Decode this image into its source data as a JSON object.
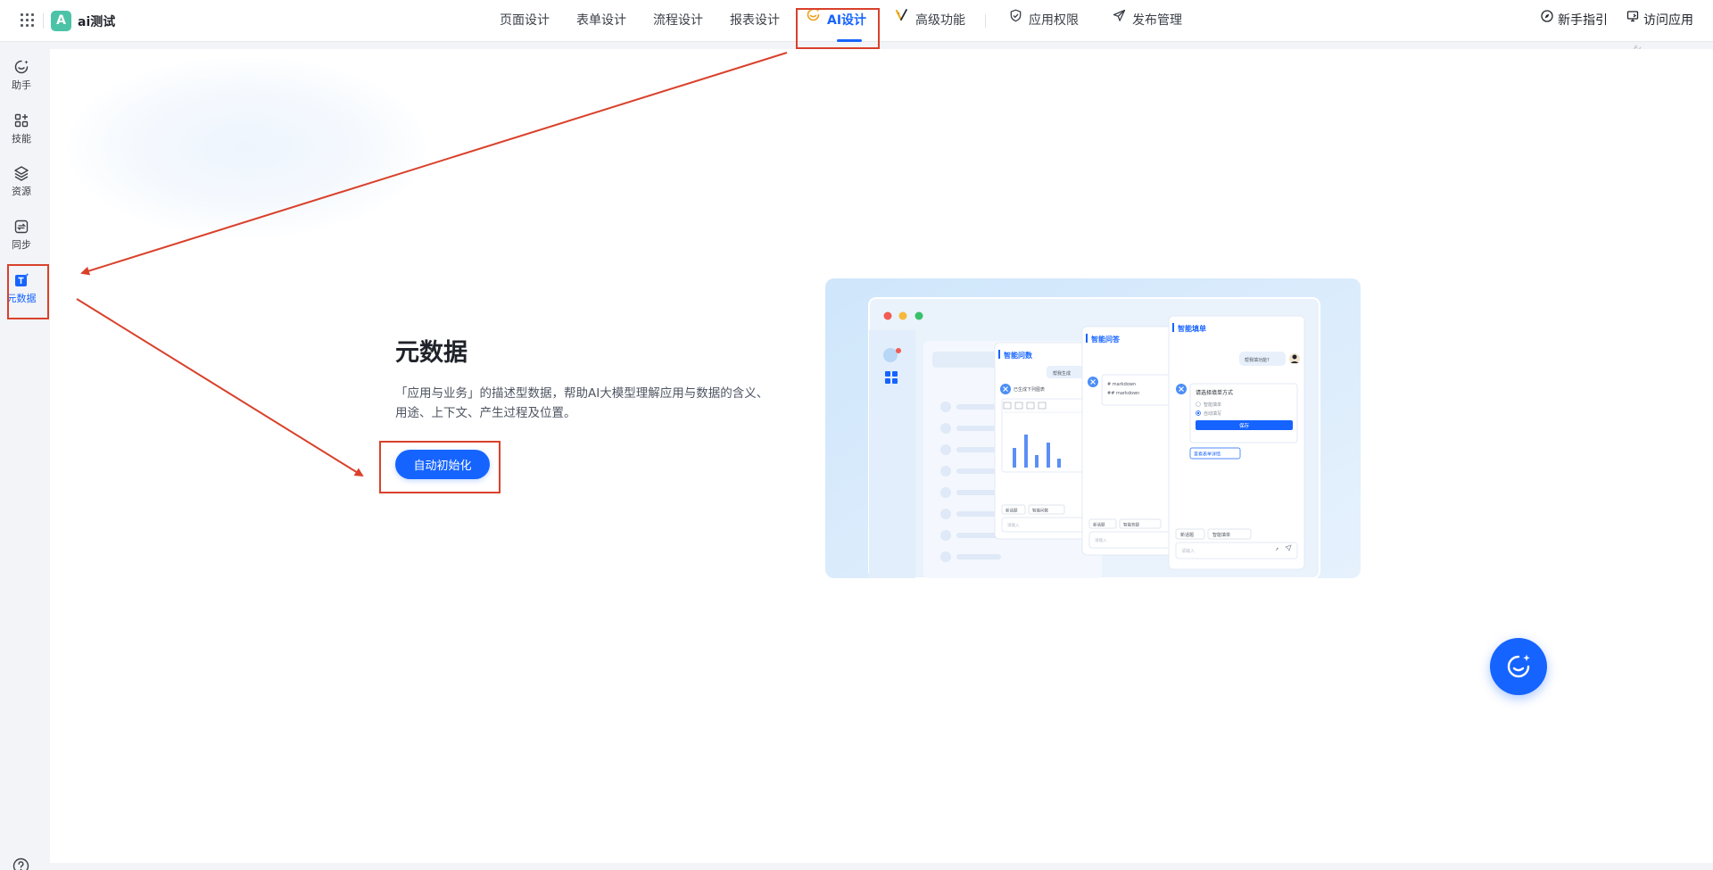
{
  "app": {
    "logo_letter": "A",
    "name": "ai测试"
  },
  "nav": {
    "items": [
      {
        "label": "页面设计"
      },
      {
        "label": "表单设计"
      },
      {
        "label": "流程设计"
      },
      {
        "label": "报表设计"
      },
      {
        "label": "AI设计",
        "active": true
      },
      {
        "label": "高级功能"
      },
      {
        "label": "应用权限"
      },
      {
        "label": "发布管理"
      }
    ]
  },
  "top_right": {
    "guide": "新手指引",
    "visit": "访问应用"
  },
  "watermark": "tke-saas-uat",
  "sidebar": {
    "items": [
      {
        "label": "助手"
      },
      {
        "label": "技能"
      },
      {
        "label": "资源"
      },
      {
        "label": "同步"
      },
      {
        "label": "元数据",
        "active": true
      }
    ]
  },
  "main": {
    "title": "元数据",
    "description": "「应用与业务」的描述型数据，帮助AI大模型理解应用与数据的含义、用途、上下文、产生过程及位置。",
    "button_label": "自动初始化"
  },
  "illustration": {
    "card1_title": "智能问数",
    "card2_title": "智能问答",
    "card3_title": "智能填单",
    "card1_bubble": "帮我生成",
    "card1_reply": "已生成下列图表",
    "card1_footer_a": "新话题",
    "card1_footer_b": "智能问数",
    "card1_input": "请输入",
    "card2_line_a": "# markdown",
    "card2_line_b": "## markdown",
    "card2_footer_a": "新话题",
    "card2_footer_b": "智能答疑",
    "card2_input": "请输入",
    "card3_bubble": "帮我填功能?",
    "card3_prompt": "请选择填单方式",
    "card3_option_a": "智能填单",
    "card3_option_b": "自动填写",
    "card3_save": "保存",
    "card3_view": "查看表单详情",
    "card3_footer_a": "新话题",
    "card3_footer_b": "智能填单",
    "card3_input": "请输入"
  },
  "colors": {
    "accent": "#1664ff",
    "annotation": "#d9412b"
  }
}
